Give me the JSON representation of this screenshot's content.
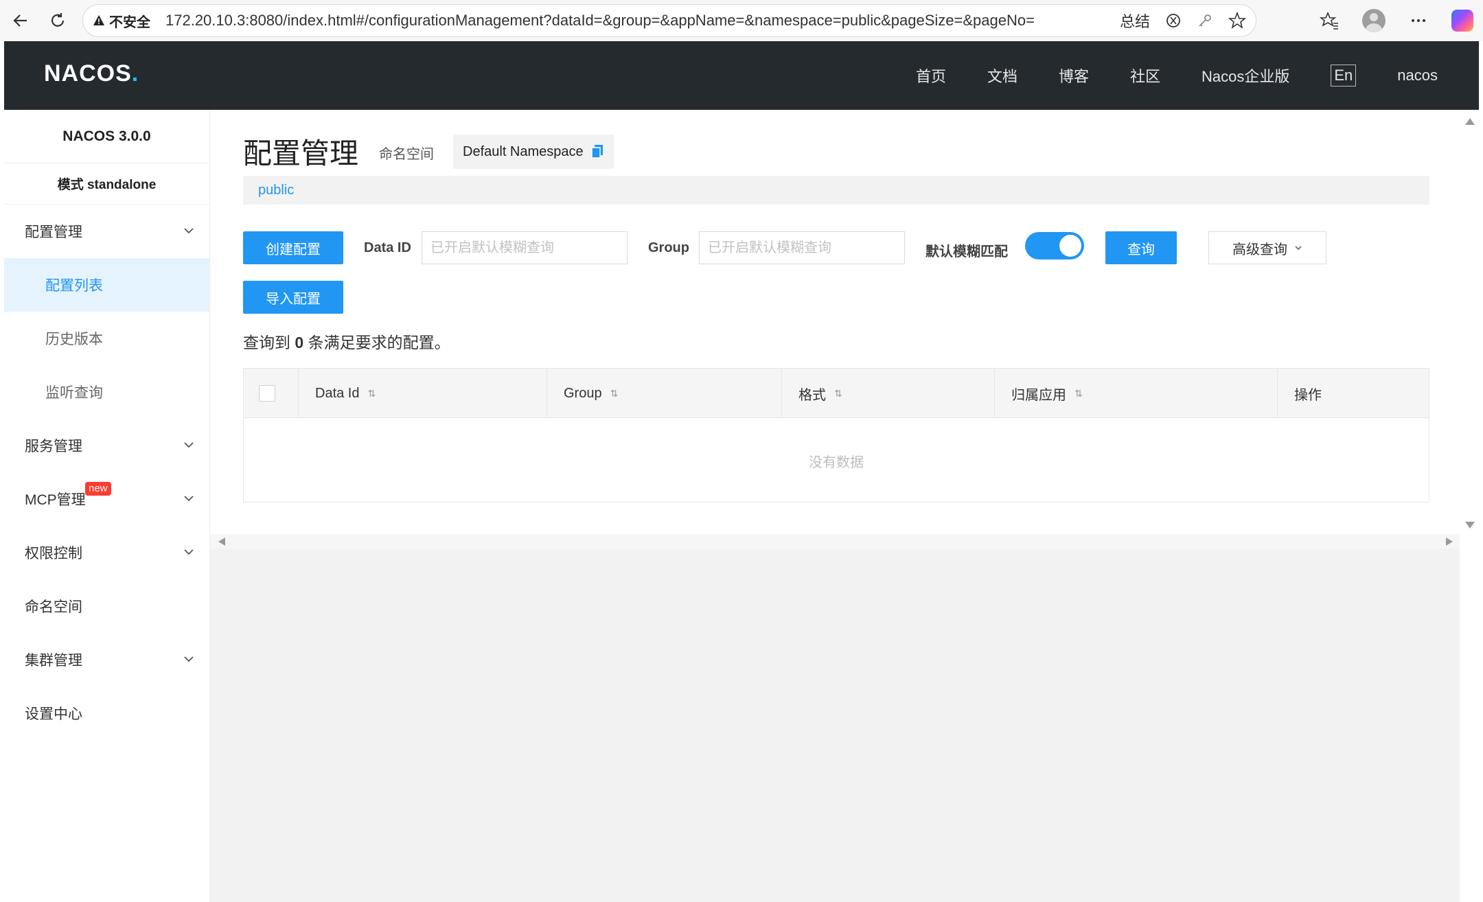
{
  "browser": {
    "security_label": "不安全",
    "url": "172.20.10.3:8080/index.html#/configurationManagement?dataId=&group=&appName=&namespace=public&pageSize=&pageNo=",
    "summarize_label": "总结"
  },
  "header": {
    "logo_text": "NACOS",
    "logo_dot": ".",
    "nav": [
      "首页",
      "文档",
      "博客",
      "社区",
      "Nacos企业版"
    ],
    "lang": "En",
    "user": "nacos"
  },
  "sidebar": {
    "version": "NACOS 3.0.0",
    "mode": "模式 standalone",
    "items": [
      {
        "label": "配置管理",
        "expandable": true
      },
      {
        "label": "配置列表",
        "active": true,
        "sub": true
      },
      {
        "label": "历史版本",
        "sub": true
      },
      {
        "label": "监听查询",
        "sub": true
      },
      {
        "label": "服务管理",
        "expandable": true
      },
      {
        "label": "MCP管理",
        "expandable": true,
        "badge": "new"
      },
      {
        "label": "权限控制",
        "expandable": true
      },
      {
        "label": "命名空间"
      },
      {
        "label": "集群管理",
        "expandable": true
      },
      {
        "label": "设置中心"
      }
    ]
  },
  "main": {
    "title": "配置管理",
    "namespace_label": "命名空间",
    "namespace_value": "Default Namespace",
    "namespace_tab": "public",
    "create_button": "创建配置",
    "import_button": "导入配置",
    "data_id_label": "Data ID",
    "data_id_placeholder": "已开启默认模糊查询",
    "group_label": "Group",
    "group_placeholder": "已开启默认模糊查询",
    "fuzzy_label": "默认模糊匹配",
    "fuzzy_enabled": true,
    "search_button": "查询",
    "advanced_button": "高级查询",
    "result_prefix": "查询到",
    "result_count": "0",
    "result_suffix": "条满足要求的配置。",
    "table": {
      "columns": [
        "Data Id",
        "Group",
        "格式",
        "归属应用",
        "操作"
      ],
      "empty_text": "没有数据"
    }
  },
  "colors": {
    "primary": "#2196f3",
    "header_bg": "#252a2f",
    "badge": "#ff3b30"
  }
}
